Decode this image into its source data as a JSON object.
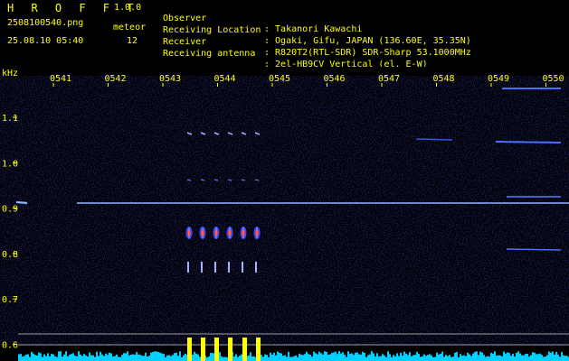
{
  "header": {
    "app_title": "H R O F F T",
    "app_version": "1.0.0",
    "file_name": "2508100540.png",
    "date_time": "25.08.10 05:40",
    "meteor_label": "meteor",
    "meteor_count": "12"
  },
  "info": [
    {
      "key": "Observer",
      "value": ": Takanori Kawachi"
    },
    {
      "key": "Receiving Location",
      "value": ": Ogaki, Gifu, JAPAN (136.60E, 35.35N)"
    },
    {
      "key": "Receiver",
      "value": ": R820T2(RTL-SDR) SDR-Sharp 53.1000MHz"
    },
    {
      "key": "Receiving antenna",
      "value": ": 2el-HB9CV Vertical (el. E-W)"
    }
  ],
  "axis": {
    "unit": "kHz",
    "time_labels": [
      "0541",
      "0542",
      "0543",
      "0544",
      "0545",
      "0546",
      "0547",
      "0548",
      "0549",
      "0550"
    ],
    "freq_labels": [
      "1.1",
      "1.0",
      "0.9",
      "0.8",
      "0.7",
      "0.6"
    ]
  },
  "colors": {
    "background": "#000000",
    "text": "#ffff00",
    "noise": "#1a1a8c",
    "carrier": "#8fb4ff",
    "bottom_bar": "#00d0ff",
    "meteor_bar": "#ffff00"
  }
}
